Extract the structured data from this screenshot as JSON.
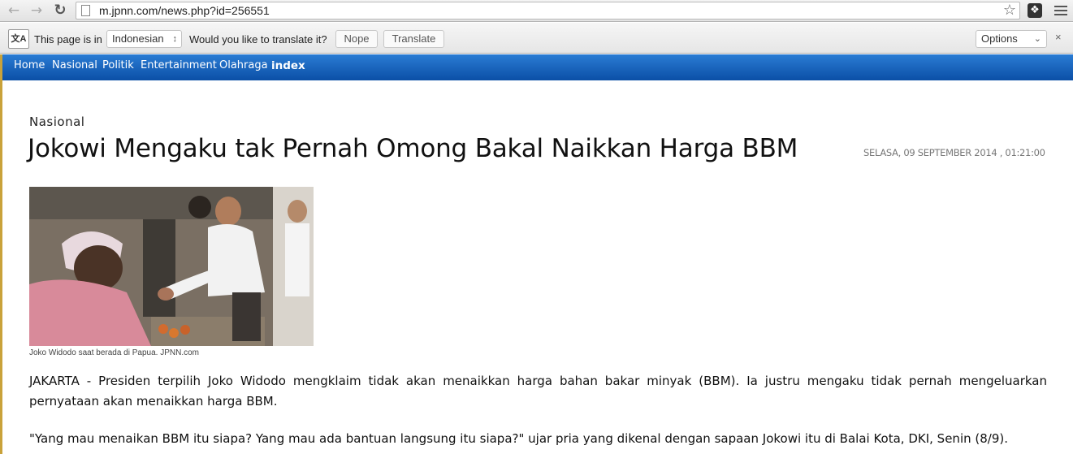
{
  "browser": {
    "url": "m.jpnn.com/news.php?id=256551",
    "icons": {
      "back": "back-arrow-icon",
      "forward": "forward-arrow-icon",
      "reload": "reload-icon",
      "page": "page-icon",
      "star": "star-icon",
      "extension": "extension-icon",
      "menu": "hamburger-menu-icon"
    }
  },
  "translate_bar": {
    "prefix": "This page is in",
    "language": "Indonesian",
    "question": "Would you like to translate it?",
    "nope_label": "Nope",
    "translate_label": "Translate",
    "options_label": "Options",
    "close_glyph": "×"
  },
  "site_nav": {
    "items": [
      {
        "label": "Home"
      },
      {
        "label": "Nasional"
      },
      {
        "label": "Politik"
      },
      {
        "label": "Entertainment"
      },
      {
        "label": "Olahraga"
      },
      {
        "label": "index"
      }
    ],
    "colors": {
      "top": "#2a7cd4",
      "bottom": "#0b4fa6",
      "accent_bar": "#c9a23a"
    }
  },
  "article": {
    "category": "Nasional",
    "title": "Jokowi Mengaku tak Pernah Omong Bakal Naikkan Harga BBM",
    "date": "SELASA, 09 SEPTEMBER 2014 , 01:21:00",
    "photo_caption": "Joko Widodo saat berada di Papua. JPNN.com",
    "paragraphs": [
      "JAKARTA - Presiden terpilih Joko Widodo mengklaim tidak akan menaikkan harga bahan bakar minyak (BBM). Ia justru mengaku tidak pernah mengeluarkan pernyataan akan menaikkan harga BBM.",
      "\"Yang mau menaikan BBM itu siapa? Yang mau ada bantuan langsung itu siapa?\" ujar pria yang dikenal dengan sapaan Jokowi itu di Balai Kota, DKI, Senin (8/9)."
    ]
  }
}
